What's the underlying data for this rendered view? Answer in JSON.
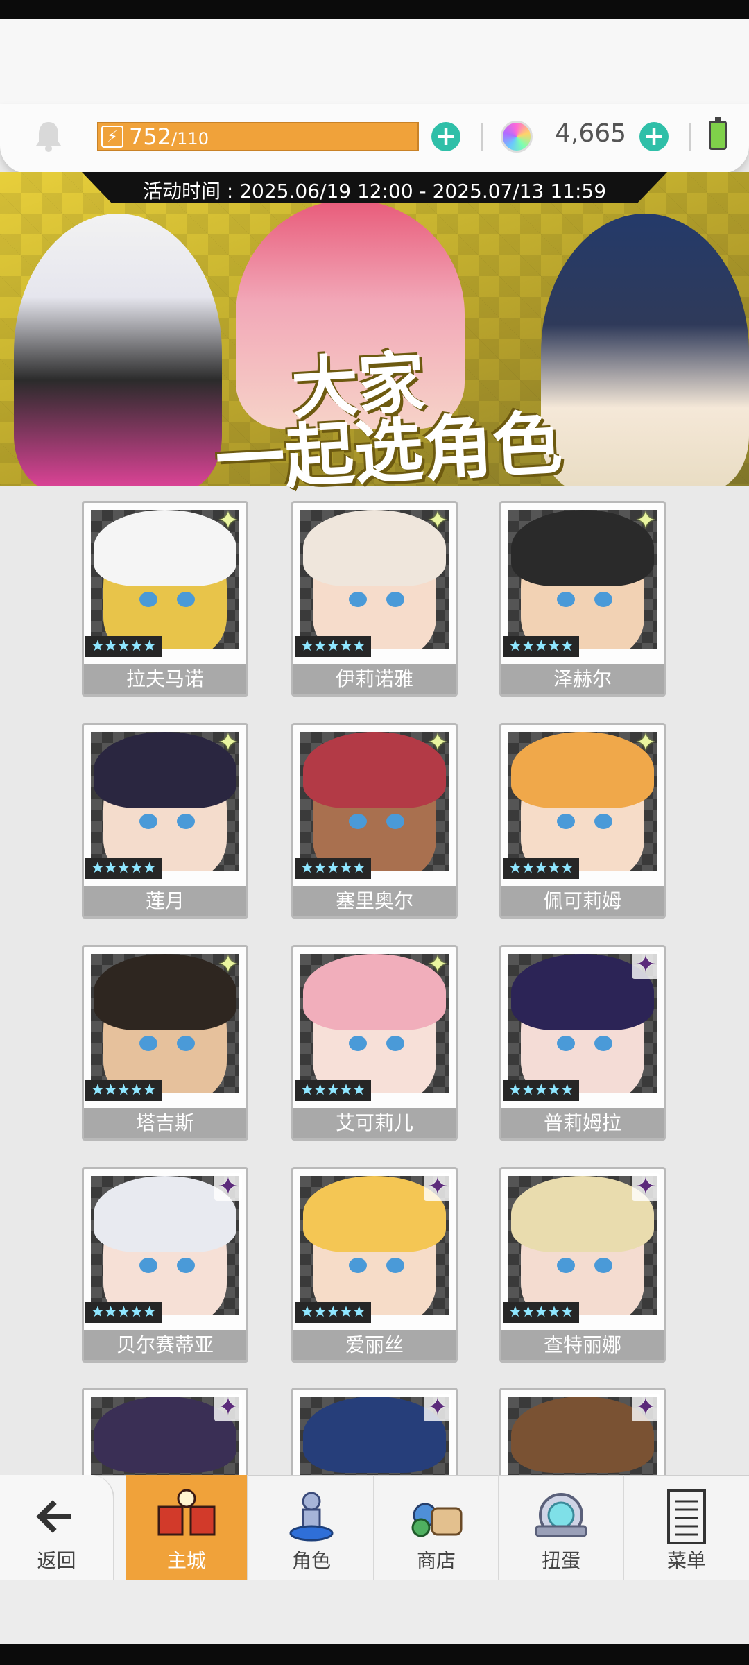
{
  "topbar": {
    "stamina_current": "752",
    "stamina_max": "/110",
    "gem_count": "4,665",
    "stamina_fill": 1.0
  },
  "banner": {
    "event_time": "活动时间 : 2025.06/19 12:00 - 2025.07/13 11:59",
    "title_line1": "大家",
    "title_line2": "一起选角色"
  },
  "characters": [
    {
      "name": "拉夫马诺",
      "stars": "★★★★★",
      "element": "light"
    },
    {
      "name": "伊莉诺雅",
      "stars": "★★★★★",
      "element": "light"
    },
    {
      "name": "泽赫尔",
      "stars": "★★★★★",
      "element": "light"
    },
    {
      "name": "莲月",
      "stars": "★★★★★",
      "element": "light"
    },
    {
      "name": "塞里奥尔",
      "stars": "★★★★★",
      "element": "light"
    },
    {
      "name": "佩可莉姆",
      "stars": "★★★★★",
      "element": "light"
    },
    {
      "name": "塔吉斯",
      "stars": "★★★★★",
      "element": "light"
    },
    {
      "name": "艾可莉儿",
      "stars": "★★★★★",
      "element": "light"
    },
    {
      "name": "普莉姆拉",
      "stars": "★★★★★",
      "element": "dark"
    },
    {
      "name": "贝尔赛蒂亚",
      "stars": "★★★★★",
      "element": "dark"
    },
    {
      "name": "爱丽丝",
      "stars": "★★★★★",
      "element": "dark"
    },
    {
      "name": "查特丽娜",
      "stars": "★★★★★",
      "element": "dark"
    }
  ],
  "nav": {
    "back": "返回",
    "home": "主城",
    "characters": "角色",
    "shop": "商店",
    "gacha": "扭蛋",
    "menu": "菜单"
  },
  "colors": {
    "accent_orange": "#f0a23a",
    "plus_teal": "#2fbfa8",
    "name_bar": "#a9a9a9"
  }
}
